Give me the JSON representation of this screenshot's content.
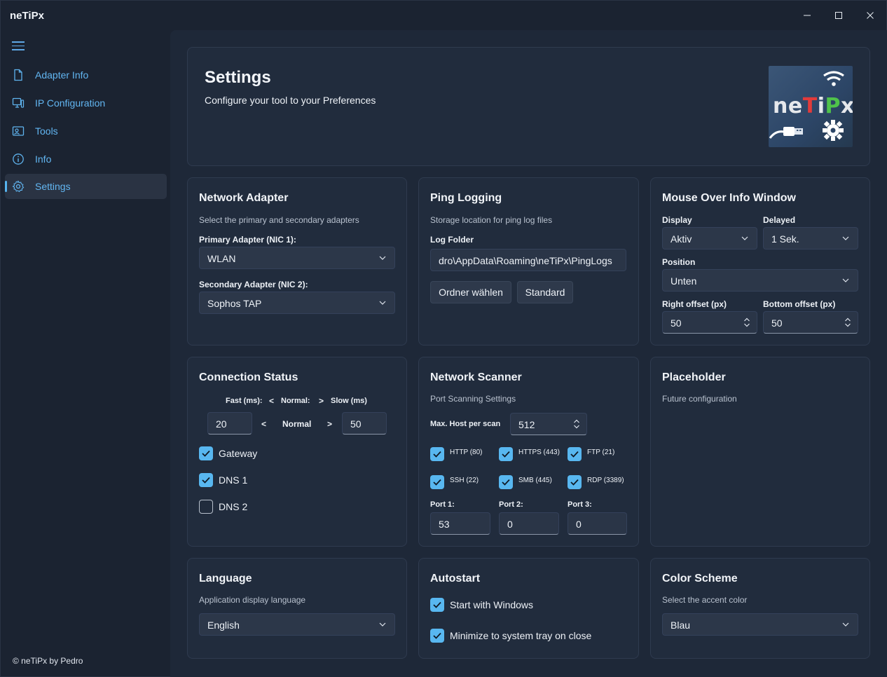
{
  "app": {
    "title": "neTiPx"
  },
  "window_controls": {
    "minimize": "—",
    "maximize": "☐",
    "close": "✕"
  },
  "sidebar": {
    "items": [
      {
        "label": "Adapter Info",
        "icon": "document-icon"
      },
      {
        "label": "IP Configuration",
        "icon": "monitor-icon"
      },
      {
        "label": "Tools",
        "icon": "toolbox-icon"
      },
      {
        "label": "Info",
        "icon": "info-icon"
      },
      {
        "label": "Settings",
        "icon": "gear-icon"
      }
    ],
    "active": "Settings",
    "footer": "© neTiPx by Pedro"
  },
  "header": {
    "title": "Settings",
    "subtitle": "Configure your tool to your Preferences",
    "logo_text": "neTiPx"
  },
  "network_adapter": {
    "title": "Network Adapter",
    "subtitle": "Select the primary and secondary adapters",
    "primary_label": "Primary Adapter (NIC 1):",
    "primary_value": "WLAN",
    "secondary_label": "Secondary Adapter (NIC 2):",
    "secondary_value": "Sophos TAP"
  },
  "ping_logging": {
    "title": "Ping Logging",
    "subtitle": "Storage location for ping log files",
    "folder_label": "Log Folder",
    "folder_value": "dro\\AppData\\Roaming\\neTiPx\\PingLogs",
    "choose_button": "Ordner wählen",
    "default_button": "Standard"
  },
  "mouse_over": {
    "title": "Mouse Over Info Window",
    "display_label": "Display",
    "display_value": "Aktiv",
    "delayed_label": "Delayed",
    "delayed_value": "1 Sek.",
    "position_label": "Position",
    "position_value": "Unten",
    "right_offset_label": "Right offset (px)",
    "right_offset_value": "50",
    "bottom_offset_label": "Bottom offset (px)",
    "bottom_offset_value": "50"
  },
  "connection_status": {
    "title": "Connection Status",
    "fast_label": "Fast (ms):",
    "lt1": "<",
    "normal_label": "Normal:",
    "gt1": ">",
    "slow_label": "Slow (ms)",
    "fast_value": "20",
    "lt2": "<",
    "normal_mid": "Normal",
    "gt2": ">",
    "slow_value": "50",
    "checks": [
      {
        "label": "Gateway",
        "checked": true
      },
      {
        "label": "DNS 1",
        "checked": true
      },
      {
        "label": "DNS 2",
        "checked": false
      }
    ]
  },
  "network_scanner": {
    "title": "Network Scanner",
    "subtitle": "Port Scanning Settings",
    "max_host_label": "Max. Host per scan",
    "max_host_value": "512",
    "ports": [
      {
        "label": "HTTP (80)",
        "checked": true
      },
      {
        "label": "HTTPS (443)",
        "checked": true
      },
      {
        "label": "FTP (21)",
        "checked": true
      },
      {
        "label": "SSH (22)",
        "checked": true
      },
      {
        "label": "SMB (445)",
        "checked": true
      },
      {
        "label": "RDP (3389)",
        "checked": true
      }
    ],
    "port1_label": "Port 1:",
    "port1_value": "53",
    "port2_label": "Port 2:",
    "port2_value": "0",
    "port3_label": "Port 3:",
    "port3_value": "0"
  },
  "placeholder": {
    "title": "Placeholder",
    "subtitle": "Future configuration"
  },
  "language": {
    "title": "Language",
    "subtitle": "Application display language",
    "value": "English"
  },
  "autostart": {
    "title": "Autostart",
    "checks": [
      {
        "label": "Start with Windows",
        "checked": true
      },
      {
        "label": "Minimize to system tray on close",
        "checked": true
      }
    ]
  },
  "color_scheme": {
    "title": "Color Scheme",
    "subtitle": "Select the accent color",
    "value": "Blau"
  },
  "colors": {
    "accent": "#58b7f0",
    "background": "#1b2331",
    "card": "#212c3d"
  }
}
